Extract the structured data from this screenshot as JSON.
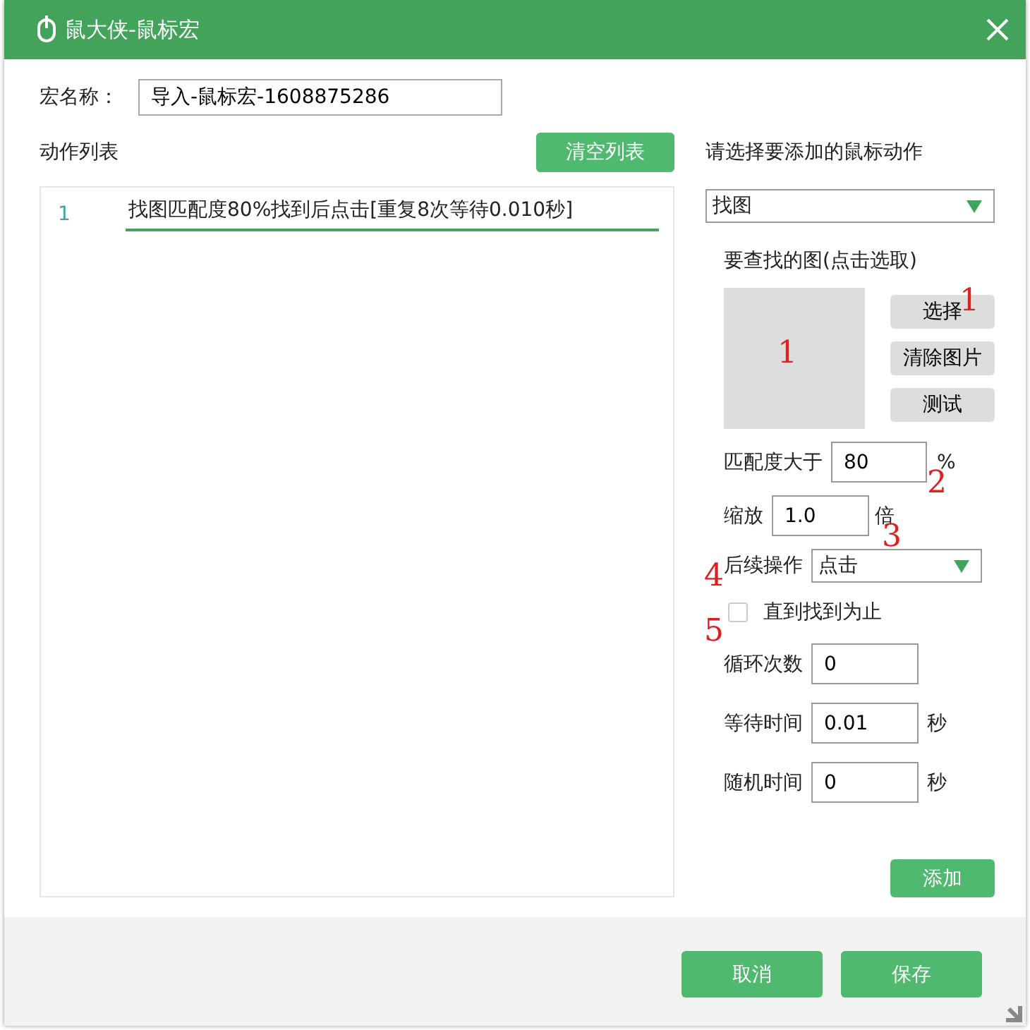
{
  "window": {
    "title": "鼠大侠-鼠标宏"
  },
  "macro_name": {
    "label": "宏名称：",
    "value": "导入-鼠标宏-1608875286"
  },
  "action_list": {
    "title": "动作列表",
    "clear_button": "清空列表",
    "rows": [
      {
        "number": "1",
        "text": "找图匹配度80%找到后点击[重复8次等待0.010秒]",
        "selected": true
      }
    ]
  },
  "add_panel": {
    "title": "请选择要添加的鼠标动作",
    "action_select": "找图",
    "image_label": "要查找的图(点击选取)",
    "image_buttons": [
      "选择",
      "清除图片",
      "测试"
    ],
    "match": {
      "label": "匹配度大于",
      "value": "80",
      "unit": "%"
    },
    "scale": {
      "label": "缩放",
      "value": "1.0",
      "unit": "倍"
    },
    "follow_up": {
      "label": "后续操作",
      "value": "点击"
    },
    "until_found": {
      "label": "直到找到为止",
      "checked": false
    },
    "fields": [
      {
        "label": "循环次数",
        "value": "0"
      },
      {
        "label": "等待时间",
        "value": "0.01",
        "unit": "秒"
      },
      {
        "label": "随机时间",
        "value": "0",
        "unit": "秒"
      }
    ],
    "add_button": "添加"
  },
  "buttons": [
    "取消",
    "保存"
  ],
  "annotations": [
    {
      "text": "1"
    },
    {
      "text": "1"
    },
    {
      "text": "2"
    },
    {
      "text": "3"
    },
    {
      "text": "4"
    },
    {
      "text": "5"
    }
  ]
}
